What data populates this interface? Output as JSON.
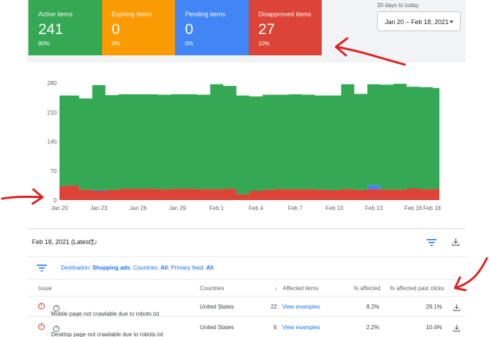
{
  "summary_tiles": [
    {
      "label": "Active items",
      "value": "241",
      "pct": "90%",
      "color": "#34a853"
    },
    {
      "label": "Expiring items",
      "value": "0",
      "pct": "0%",
      "color": "#fb9b04"
    },
    {
      "label": "Pending items",
      "value": "0",
      "pct": "0%",
      "color": "#4285f4"
    },
    {
      "label": "Disapproved items",
      "value": "27",
      "pct": "10%",
      "color": "#db4437"
    }
  ],
  "date_range": {
    "caption": "30 days to today",
    "value": "Jan 20 – Feb 18, 2021"
  },
  "chart_data": {
    "type": "area",
    "stacked": true,
    "x": [
      "Jan 20",
      "Jan 21",
      "Jan 22",
      "Jan 23",
      "Jan 24",
      "Jan 25",
      "Jan 26",
      "Jan 27",
      "Jan 28",
      "Jan 29",
      "Jan 30",
      "Jan 31",
      "Feb 1",
      "Feb 2",
      "Feb 3",
      "Feb 4",
      "Feb 5",
      "Feb 6",
      "Feb 7",
      "Feb 8",
      "Feb 9",
      "Feb 10",
      "Feb 11",
      "Feb 12",
      "Feb 13",
      "Feb 14",
      "Feb 15",
      "Feb 16",
      "Feb 17",
      "Feb 18"
    ],
    "x_tick_labels": [
      "Jan 20",
      "Jan 23",
      "Jan 26",
      "Jan 29",
      "Feb 1",
      "Feb 4",
      "Feb 7",
      "Feb 10",
      "Feb 13",
      "Feb 16",
      "Feb 18"
    ],
    "series": [
      {
        "color": "#db4437",
        "values": [
          33,
          35,
          25,
          22,
          24,
          27,
          27,
          27,
          26,
          27,
          27,
          26,
          26,
          27,
          14,
          22,
          25,
          26,
          26,
          26,
          25,
          24,
          26,
          24,
          26,
          25,
          25,
          28,
          26,
          27
        ]
      },
      {
        "color": "#4285f4",
        "values": [
          0,
          0,
          0,
          2,
          0,
          0,
          0,
          0,
          0,
          0,
          0,
          0,
          0,
          0,
          0,
          0,
          0,
          0,
          0,
          0,
          0,
          0,
          0,
          0,
          10,
          0,
          0,
          0,
          0,
          0
        ]
      },
      {
        "color": "#34a853",
        "values": [
          217,
          215,
          218,
          251,
          227,
          226,
          226,
          226,
          226,
          226,
          226,
          226,
          251,
          246,
          236,
          226,
          227,
          226,
          227,
          226,
          225,
          226,
          251,
          230,
          241,
          251,
          253,
          243,
          244,
          241
        ]
      }
    ],
    "ylim": [
      0,
      280
    ],
    "yticks": [
      0,
      70,
      140,
      210,
      280
    ],
    "grid": false
  },
  "report": {
    "date_label": "Feb 18, 2021 (Latest)",
    "refresh_icon": "refresh-icon",
    "filter_icon": "filter-icon",
    "download_icon": "download-icon"
  },
  "filter": {
    "destination_label": "Destination:",
    "destination_value": "Shopping ads",
    "countries_label": "Countries:",
    "countries_value": "All",
    "feed_label": "Primary feed:",
    "feed_value": "All"
  },
  "table": {
    "headers": {
      "issue": "Issue",
      "countries": "Countries",
      "affected": "Affected items",
      "pct_affected": "% affected",
      "pct_past_clicks": "% affected past clicks"
    },
    "rows": [
      {
        "issue": "Mobile page not crawlable due to robots.txt",
        "countries": "United States",
        "affected": "22",
        "action": "View examples",
        "pct_affected": "8.2%",
        "pct_past_clicks": "29.1%"
      },
      {
        "issue": "Desktop page not crawlable due to robots.txt",
        "countries": "United States",
        "affected": "6",
        "action": "View examples",
        "pct_affected": "2.2%",
        "pct_past_clicks": "10.4%"
      }
    ]
  },
  "annotation_color": "#e02020"
}
